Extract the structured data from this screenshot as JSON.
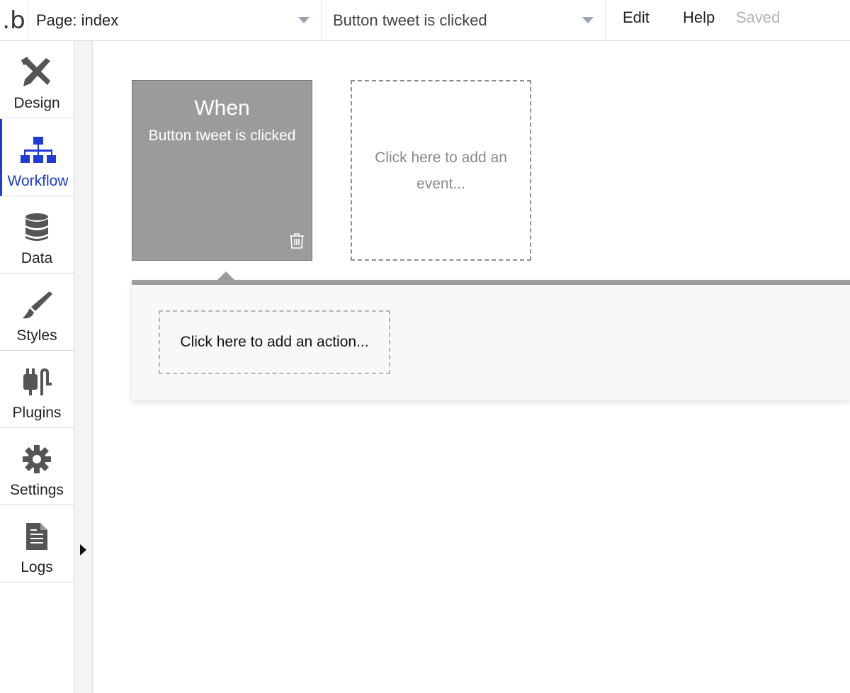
{
  "topbar": {
    "logo": ".b",
    "page_dropdown": "Page: index",
    "event_dropdown": "Button tweet is clicked",
    "menu": {
      "edit": "Edit",
      "help": "Help",
      "saved": "Saved"
    }
  },
  "sidebar": {
    "items": [
      {
        "label": "Design",
        "icon": "design-icon"
      },
      {
        "label": "Workflow",
        "icon": "workflow-icon",
        "active": true
      },
      {
        "label": "Data",
        "icon": "database-icon"
      },
      {
        "label": "Styles",
        "icon": "brush-icon"
      },
      {
        "label": "Plugins",
        "icon": "plugin-icon"
      },
      {
        "label": "Settings",
        "icon": "gear-icon"
      },
      {
        "label": "Logs",
        "icon": "document-icon"
      }
    ]
  },
  "canvas": {
    "event_card": {
      "title": "When",
      "event": "Button tweet is clicked"
    },
    "add_event": "Click here to add an event...",
    "add_action": "Click here to add an action..."
  },
  "colors": {
    "accent": "#1f3ad6",
    "event_card_bg": "#9b9b9b",
    "saved_text": "#b3b3b3"
  }
}
